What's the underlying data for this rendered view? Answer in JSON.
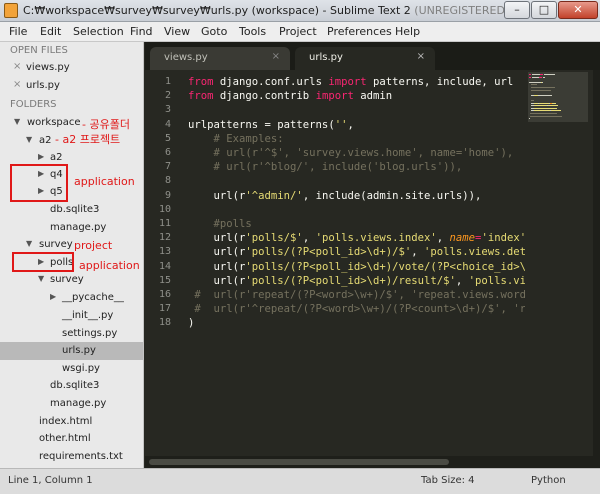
{
  "window": {
    "title_main": "C:₩workspace₩survey₩survey₩urls.py (workspace) - Sublime Text 2",
    "title_suffix": " (UNREGISTERED)",
    "min_label": "–",
    "max_label": "□",
    "close_label": "✕"
  },
  "menu": [
    "File",
    "Edit",
    "Selection",
    "Find",
    "View",
    "Goto",
    "Tools",
    "Project",
    "Preferences",
    "Help"
  ],
  "sidebar": {
    "open_files_header": "OPEN FILES",
    "open_files": [
      "views.py",
      "urls.py"
    ],
    "folders_header": "FOLDERS",
    "close_glyph": "×",
    "expanded_arrow": "▼",
    "collapsed_arrow": "▶",
    "tree": [
      {
        "label": "workspace",
        "arrow": "expanded"
      },
      {
        "label": "a2",
        "arrow": "expanded"
      },
      {
        "label": "a2",
        "arrow": "collapsed"
      },
      {
        "label": "q4",
        "arrow": "collapsed"
      },
      {
        "label": "q5",
        "arrow": "collapsed"
      },
      {
        "label": "db.sqlite3",
        "arrow": "none"
      },
      {
        "label": "manage.py",
        "arrow": "none"
      },
      {
        "label": "survey",
        "arrow": "expanded"
      },
      {
        "label": "polls",
        "arrow": "collapsed"
      },
      {
        "label": "survey",
        "arrow": "expanded"
      },
      {
        "label": "__pycache__",
        "arrow": "collapsed"
      },
      {
        "label": "__init__.py",
        "arrow": "none"
      },
      {
        "label": "settings.py",
        "arrow": "none"
      },
      {
        "label": "urls.py",
        "arrow": "none",
        "selected": true
      },
      {
        "label": "wsgi.py",
        "arrow": "none"
      },
      {
        "label": "db.sqlite3",
        "arrow": "none"
      },
      {
        "label": "manage.py",
        "arrow": "none"
      },
      {
        "label": "index.html",
        "arrow": "none"
      },
      {
        "label": "other.html",
        "arrow": "none"
      },
      {
        "label": "requirements.txt",
        "arrow": "none"
      }
    ]
  },
  "annotations": {
    "workspace_note": "- 공유폴더",
    "a2_note": "- a2 프로젝트",
    "application_1": "application",
    "project": "project",
    "application_2": "application",
    "color": "#e01818"
  },
  "tabs": [
    {
      "label": "views.py",
      "close": "×",
      "active": false
    },
    {
      "label": "urls.py",
      "close": "×",
      "active": true
    }
  ],
  "editor": {
    "line_numbers": [
      "1",
      "2",
      "3",
      "4",
      "5",
      "6",
      "7",
      "8",
      "9",
      "10",
      "11",
      "12",
      "13",
      "14",
      "15",
      "16",
      "17",
      "18"
    ],
    "lines": [
      [
        [
          "kw",
          "from"
        ],
        [
          "plain",
          " django.conf.urls "
        ],
        [
          "kw",
          "import"
        ],
        [
          "plain",
          " patterns, include, url"
        ]
      ],
      [
        [
          "kw",
          "from"
        ],
        [
          "plain",
          " django.contrib "
        ],
        [
          "kw",
          "import"
        ],
        [
          "plain",
          " admin"
        ]
      ],
      [],
      [
        [
          "plain",
          "urlpatterns = patterns("
        ],
        [
          "str",
          "''"
        ],
        [
          "plain",
          ","
        ]
      ],
      [
        [
          "cmt",
          "    # Examples:"
        ]
      ],
      [
        [
          "cmt",
          "    # url(r'^$', 'survey.views.home', name='home'),"
        ]
      ],
      [
        [
          "cmt",
          "    # url(r'^blog/', include('blog.urls')),"
        ]
      ],
      [],
      [
        [
          "plain",
          "    url(r"
        ],
        [
          "str",
          "'^admin/'"
        ],
        [
          "plain",
          ", include(admin.site.urls)),"
        ]
      ],
      [],
      [
        [
          "cmt",
          "    #polls"
        ]
      ],
      [
        [
          "plain",
          "    url(r"
        ],
        [
          "str",
          "'polls/$'"
        ],
        [
          "plain",
          ", "
        ],
        [
          "str",
          "'polls.views.index'"
        ],
        [
          "plain",
          ", "
        ],
        [
          "param",
          "name"
        ],
        [
          "kw",
          "="
        ],
        [
          "str",
          "'index'"
        ]
      ],
      [
        [
          "plain",
          "    url(r"
        ],
        [
          "str",
          "'polls/(?P<poll_id>\\d+)/$'"
        ],
        [
          "plain",
          ", "
        ],
        [
          "str",
          "'polls.views.detail'"
        ]
      ],
      [
        [
          "plain",
          "    url(r"
        ],
        [
          "str",
          "'polls/(?P<poll_id>\\d+)/vote/(?P<choice_id>\\d+)"
        ]
      ],
      [
        [
          "plain",
          "    url(r"
        ],
        [
          "str",
          "'polls/(?P<poll_id>\\d+)/result/$'"
        ],
        [
          "plain",
          ", "
        ],
        [
          "str",
          "'polls.views.result'"
        ]
      ],
      [
        [
          "cmt",
          " #  url(r'repeat/(?P<word>\\w+)/$', 'repeat.views.word',"
        ]
      ],
      [
        [
          "cmt",
          " #  url(r'^repeat/(?P<word>\\w+)/(?P<count>\\d+)/$', 'repeat.views',"
        ]
      ],
      [
        [
          "plain",
          ")"
        ]
      ]
    ],
    "theme": {
      "background": "#272822",
      "keyword": "#f92672",
      "string": "#e6db74",
      "comment": "#75715e",
      "param": "#fd971f"
    }
  },
  "status": {
    "position": "Line 1, Column 1",
    "tab_size": "Tab Size: 4",
    "syntax": "Python"
  }
}
